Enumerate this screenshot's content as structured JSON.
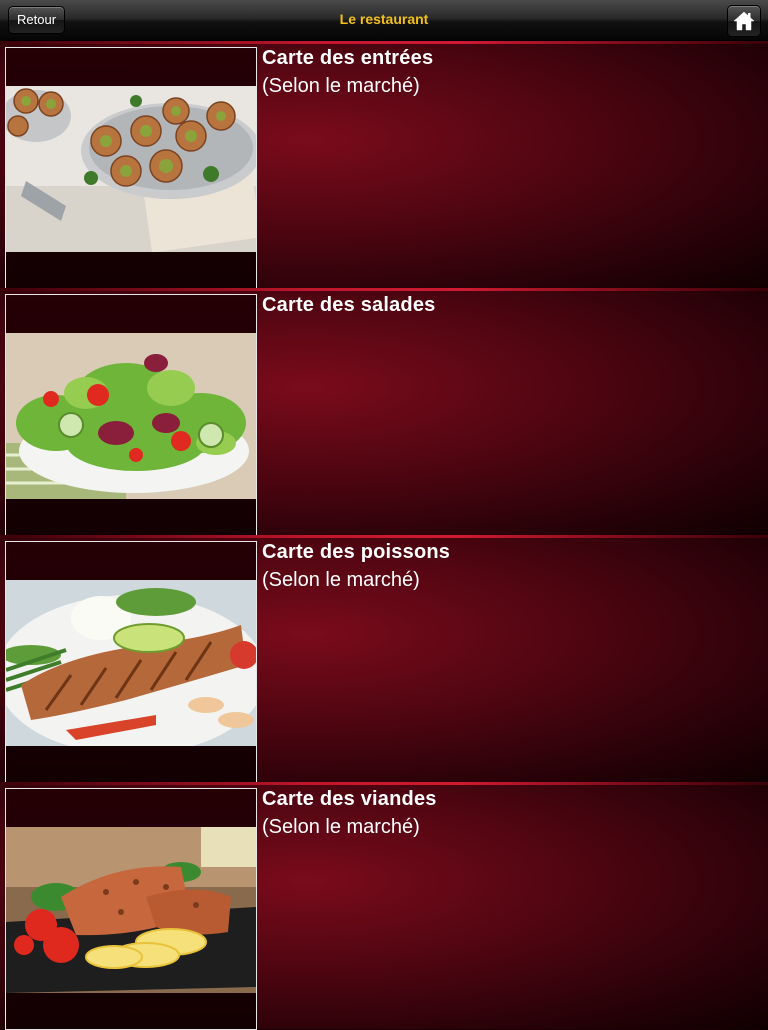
{
  "navbar": {
    "title": "Le restaurant",
    "back_label": "Retour",
    "home_icon": "home-icon",
    "title_color": "#f3c01a"
  },
  "menu": {
    "items": [
      {
        "title": "Carte des entrées",
        "subtitle": "(Selon le marché)",
        "image": "escargots-dish"
      },
      {
        "title": "Carte des salades",
        "subtitle": "",
        "image": "mixed-salad-plate"
      },
      {
        "title": "Carte des poissons",
        "subtitle": "(Selon le marché)",
        "image": "grilled-salmon-plate"
      },
      {
        "title": "Carte des viandes",
        "subtitle": "(Selon le marché)",
        "image": "salmon-with-lemon-plate"
      }
    ]
  }
}
